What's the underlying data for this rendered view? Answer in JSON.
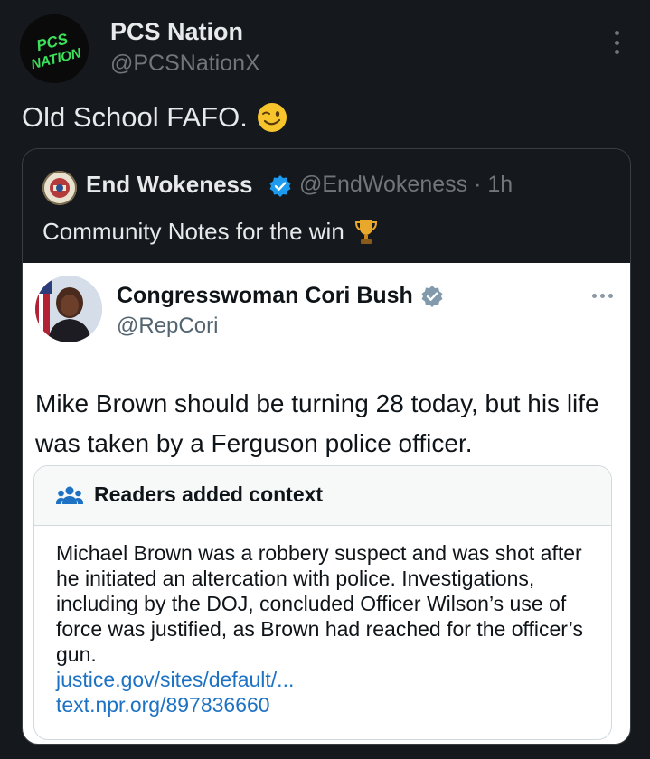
{
  "author": {
    "name": "PCS Nation",
    "handle": "@PCSNationX",
    "avatar_text_top": "PCS",
    "avatar_text_bottom": "NATION"
  },
  "post": {
    "text": "Old School FAFO.",
    "emoji": "winking-face"
  },
  "quote": {
    "name": "End Wokeness",
    "handle_time": "@EndWokeness · 1h",
    "text": "Community Notes for the win",
    "emoji": "trophy",
    "verified_color": "#1d9bf0"
  },
  "screenshot": {
    "name": "Congresswoman Cori Bush",
    "handle": "@RepCori",
    "text": "Mike Brown should be turning 28 today, but his life was taken by a Ferguson police officer.",
    "verified_color": "#829aab",
    "note": {
      "title": "Readers added context",
      "body": "Michael Brown was a robbery suspect and was shot after he initiated an altercation with police. Investigations, including by the DOJ, concluded Officer Wilson’s use of force was justified, as Brown had reached for the officer’s gun.",
      "links": [
        "justice.gov/sites/default/...",
        "text.npr.org/897836660"
      ]
    }
  },
  "colors": {
    "background": "#15181c",
    "secondary_text": "#71767b",
    "link": "#1d72c4",
    "avatar_text": "#3de05a"
  }
}
